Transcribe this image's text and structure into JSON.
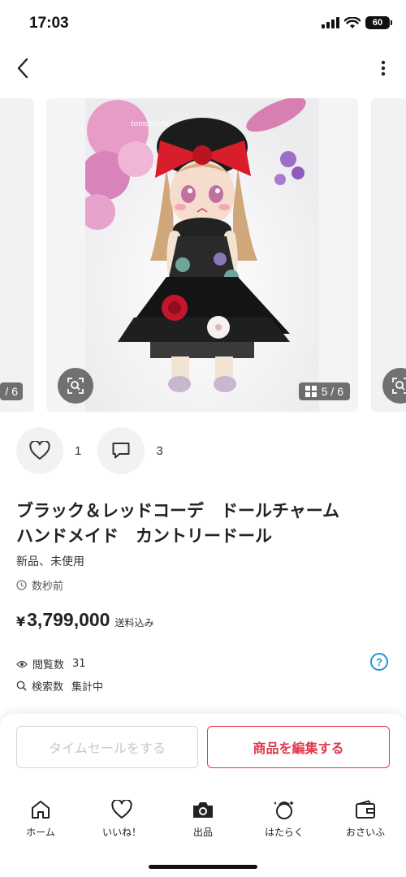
{
  "status_bar": {
    "time": "17:03",
    "battery": "60"
  },
  "gallery": {
    "prev_counter": "/ 6",
    "current_counter": "5 / 6",
    "watermark": "tomoruchi"
  },
  "actions": {
    "like_count": "1",
    "comment_count": "3"
  },
  "item": {
    "title_line1": "ブラック＆レッドコーデ　ドールチャーム",
    "title_line2": "ハンドメイド　カントリードール",
    "condition": "新品、未使用",
    "posted": "数秒前",
    "price_currency": "¥",
    "price": "3,799,000",
    "shipping_note": "送料込み"
  },
  "stats": {
    "views_label": "閲覧数",
    "views_value": "31",
    "search_label": "検索数",
    "search_value": "集計中",
    "help_symbol": "?"
  },
  "buttons": {
    "timesale": "タイムセールをする",
    "edit": "商品を編集する"
  },
  "tabbar": {
    "items": [
      {
        "label": "ホーム",
        "icon": "home-icon"
      },
      {
        "label": "いいね！",
        "icon": "heart-icon"
      },
      {
        "label": "出品",
        "icon": "camera-icon"
      },
      {
        "label": "はたらく",
        "icon": "work-icon"
      },
      {
        "label": "おさいふ",
        "icon": "wallet-icon"
      }
    ]
  },
  "colors": {
    "accent": "#e2374b",
    "help": "#2196d3",
    "doll_bow": "#d81e2a"
  }
}
